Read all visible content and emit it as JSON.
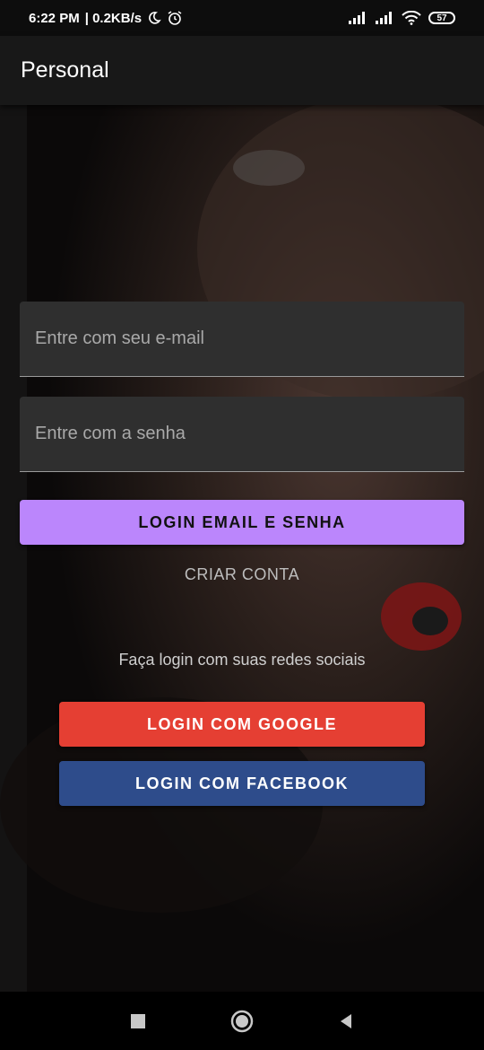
{
  "status_bar": {
    "time": "6:22 PM",
    "network_speed": "| 0.2KB/s",
    "battery_level": "57",
    "icons": [
      "moon-icon",
      "alarm-icon",
      "signal-icon",
      "signal-icon",
      "wifi-icon",
      "battery-icon"
    ]
  },
  "app_bar": {
    "title": "Personal"
  },
  "login_form": {
    "email_placeholder": "Entre com seu e-mail",
    "password_placeholder": "Entre com a senha",
    "login_button_label": "LOGIN EMAIL E SENHA",
    "create_account_label": "CRIAR CONTA"
  },
  "social_login": {
    "caption": "Faça login com suas redes sociais",
    "google_label": "LOGIN COM GOOGLE",
    "facebook_label": "LOGIN COM FACEBOOK"
  },
  "colors": {
    "primary": "#bb86fc",
    "google": "#e53f33",
    "facebook": "#2e4c8b",
    "app_bar": "#181818",
    "field": "#2f2f2f"
  },
  "nav_bar": {
    "icons": [
      "recents-icon",
      "home-icon",
      "back-icon"
    ]
  }
}
